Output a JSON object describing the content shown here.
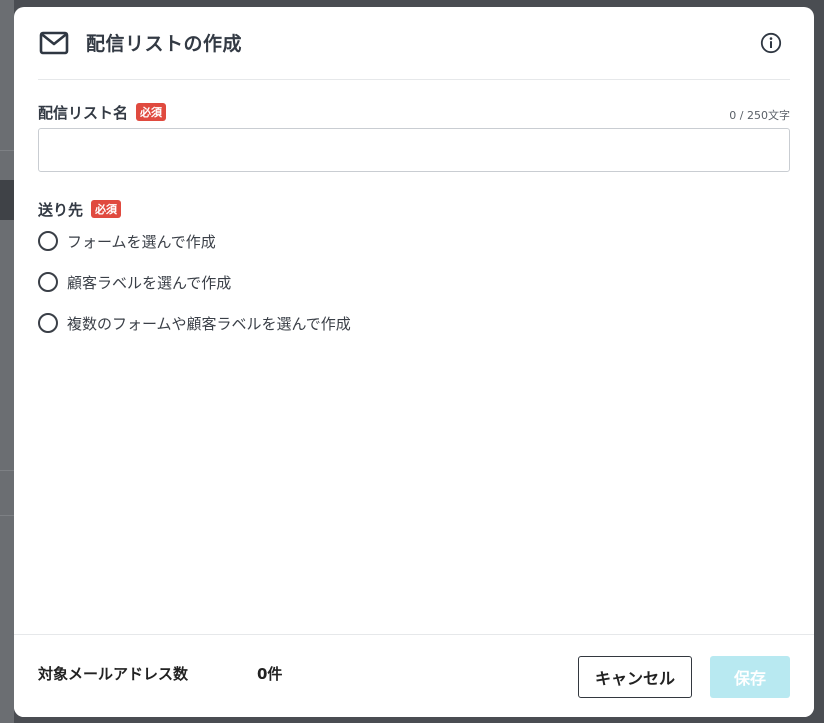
{
  "modal": {
    "title": "配信リストの作成",
    "icons": {
      "header": "mail-icon",
      "info": "info-icon"
    }
  },
  "list_name": {
    "label": "配信リスト名",
    "required_badge": "必須",
    "counter": "0 / 250文字",
    "value": "",
    "placeholder": ""
  },
  "destination": {
    "label": "送り先",
    "required_badge": "必須",
    "options": [
      {
        "label": "フォームを選んで作成"
      },
      {
        "label": "顧客ラベルを選んで作成"
      },
      {
        "label": "複数のフォームや顧客ラベルを選んで作成"
      }
    ]
  },
  "footer": {
    "count_label": "対象メールアドレス数",
    "count_value": "0件",
    "cancel_label": "キャンセル",
    "save_label": "保存"
  },
  "colors": {
    "badge": "#e04a3f",
    "save_disabled": "#b8e9f1",
    "text": "#333a44"
  }
}
